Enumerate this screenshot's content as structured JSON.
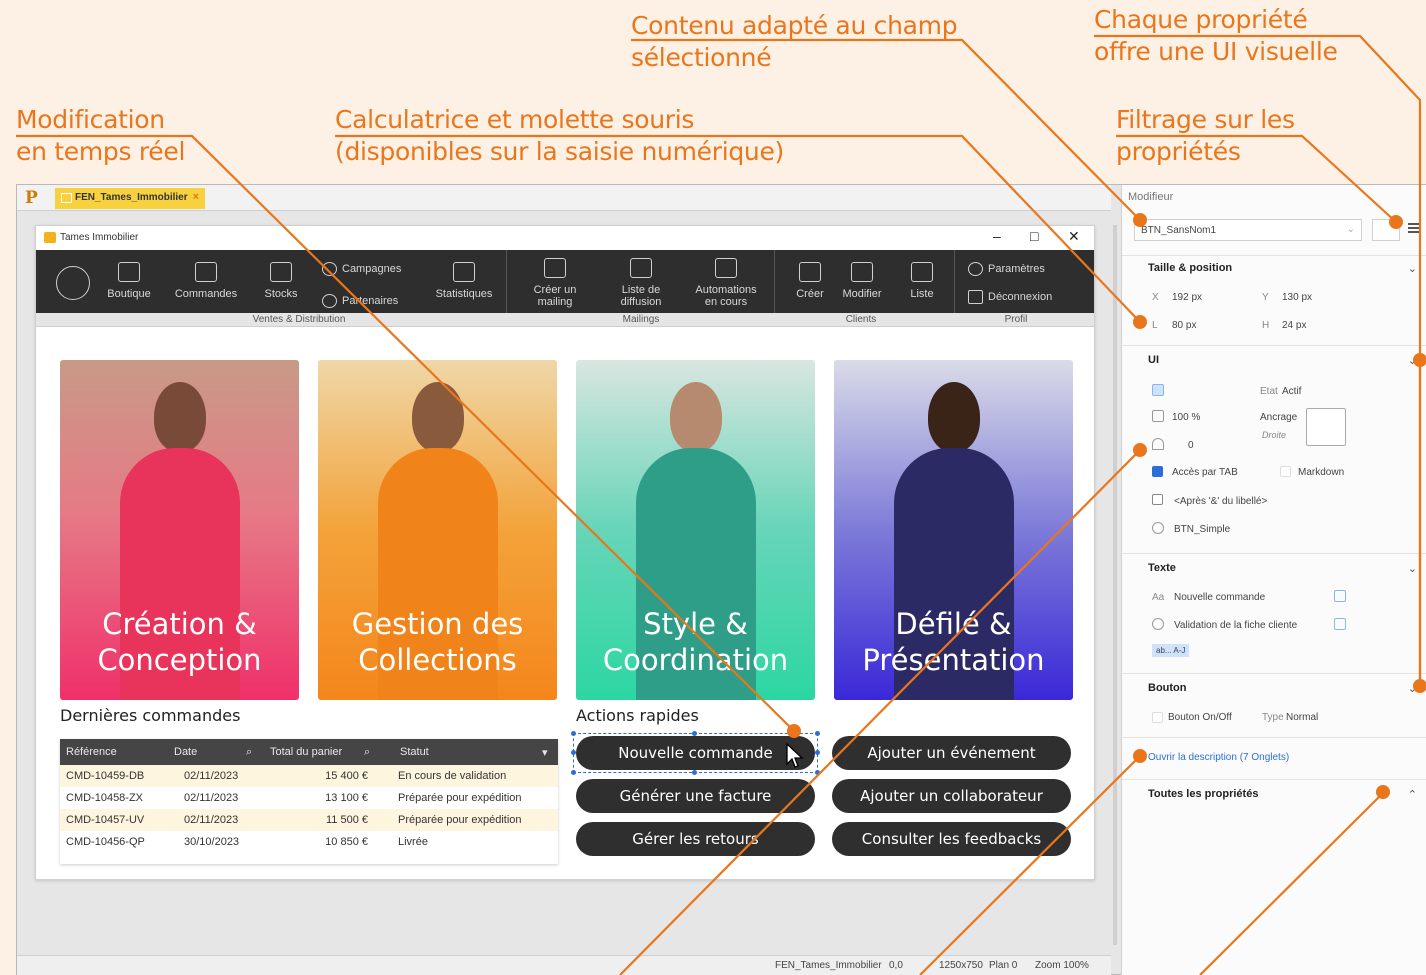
{
  "callouts": {
    "contenu": "Contenu adapté au champ\nsélectionné",
    "chaque": "Chaque propriété\noffre une UI visuelle",
    "modification": "Modification\nen temps réel",
    "calculatrice": "Calculatrice et molette souris\n(disponibles sur la saisie numérique)",
    "filtrage": "Filtrage sur les\npropriétés"
  },
  "ide": {
    "file_tab": "FEN_Tames_Immobilier",
    "close": "×",
    "logo": "P"
  },
  "window": {
    "title": "Tames Immobilier",
    "controls": {
      "minimize": "–",
      "maximize": "□",
      "close": "✕"
    }
  },
  "ribbon": {
    "groups": [
      "Ventes & Distribution",
      "Mailings",
      "Clients",
      "Profil"
    ],
    "items": {
      "boutique": "Boutique",
      "commandes": "Commandes",
      "stocks": "Stocks",
      "campagnes": "Campagnes",
      "partenaires": "Partenaires",
      "statistiques": "Statistiques",
      "creer_mailing": "Créer un\nmailing",
      "liste_diffusion": "Liste de\ndiffusion",
      "automations": "Automations\nen cours",
      "creer": "Créer",
      "modifier": "Modifier",
      "liste": "Liste",
      "parametres": "Paramètres",
      "deconnexion": "Déconnexion"
    }
  },
  "cards": [
    {
      "title": "Création &\nConception"
    },
    {
      "title": "Gestion des\nCollections"
    },
    {
      "title": "Style &\nCoordination"
    },
    {
      "title": "Défilé &\nPrésentation"
    }
  ],
  "orders": {
    "title": "Dernières commandes",
    "columns": [
      "Référence",
      "Date",
      "Total du panier",
      "Statut"
    ],
    "rows": [
      [
        "CMD-10459-DB",
        "02/11/2023",
        "15 400 €",
        "En cours de validation"
      ],
      [
        "CMD-10458-ZX",
        "02/11/2023",
        "13 100 €",
        "Préparée pour expédition"
      ],
      [
        "CMD-10457-UV",
        "02/11/2023",
        "11 500 €",
        "Préparée pour expédition"
      ],
      [
        "CMD-10456-QP",
        "30/10/2023",
        "10 850 €",
        "Livrée"
      ]
    ]
  },
  "quick_actions": {
    "title": "Actions rapides",
    "buttons": [
      "Nouvelle commande",
      "Ajouter un événement",
      "Générer une facture",
      "Ajouter un collaborateur",
      "Gérer les retours",
      "Consulter les feedbacks"
    ]
  },
  "statusbar": {
    "window": "FEN_Tames_Immobilier",
    "pos": "0,0",
    "size": "1250x750",
    "plan": "Plan 0",
    "zoom": "Zoom 100%"
  },
  "panel": {
    "title": "Modifieur",
    "selected": "BTN_SansNom1",
    "taille": {
      "label": "Taille & position",
      "x_label": "X",
      "x": "192 px",
      "y_label": "Y",
      "y": "130 px",
      "l_label": "L",
      "l": "80 px",
      "h_label": "H",
      "h": "24 px"
    },
    "ui": {
      "label": "UI",
      "etat_label": "Etat",
      "etat": "Actif",
      "opacity": "100 %",
      "ancrage": "Ancrage",
      "ancrage_value": "Droite",
      "rounding": "0",
      "acces_tab": "Accès par TAB",
      "markdown": "Markdown",
      "apres": "<Après '&' du libellé>",
      "style": "BTN_Simple"
    },
    "texte": {
      "label": "Texte",
      "aa": "Aa",
      "libelle": "Nouvelle commande",
      "bulle": "Validation de la fiche cliente",
      "sample": "ab... A-J"
    },
    "bouton": {
      "label": "Bouton",
      "onoff": "Bouton On/Off",
      "type_label": "Type",
      "type": "Normal"
    },
    "description_link": "Ouvrir la description (7 Onglets)",
    "toutes": "Toutes les propriétés"
  }
}
